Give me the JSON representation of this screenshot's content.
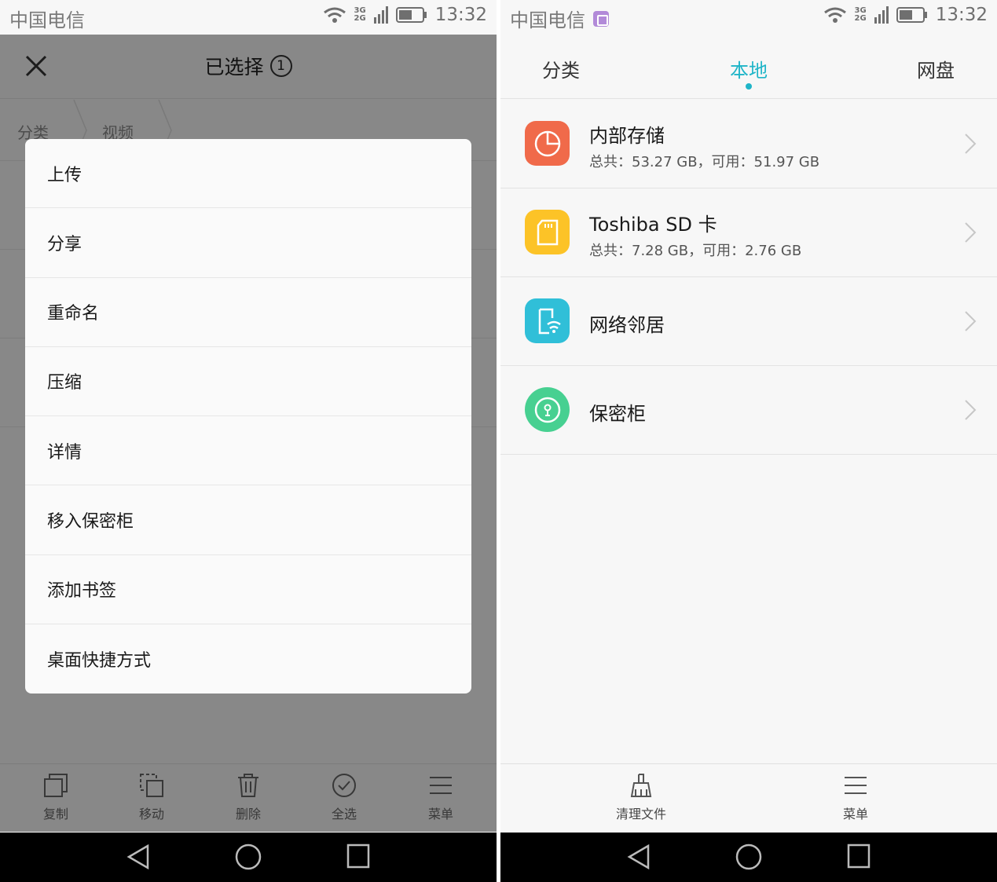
{
  "status": {
    "carrier": "中国电信",
    "network_top": "3G",
    "network_bottom": "2G",
    "time": "13:32"
  },
  "left": {
    "header_title": "已选择",
    "selected_count": "1",
    "breadcrumb": [
      "分类",
      "视频"
    ],
    "menu_items": [
      "上传",
      "分享",
      "重命名",
      "压缩",
      "详情",
      "移入保密柜",
      "添加书签",
      "桌面快捷方式"
    ],
    "toolbar": [
      "复制",
      "移动",
      "删除",
      "全选",
      "菜单"
    ]
  },
  "right": {
    "tabs": [
      "分类",
      "本地",
      "网盘"
    ],
    "active_tab": "本地",
    "storage": [
      {
        "title": "内部存储",
        "subtitle": "总共：53.27 GB，可用：51.97 GB",
        "icon": "pie-chart-icon",
        "color": "#f06a4a"
      },
      {
        "title": "Toshiba SD 卡",
        "subtitle": "总共：7.28 GB，可用：2.76 GB",
        "icon": "sd-card-icon",
        "color": "#fcc327"
      },
      {
        "title": "网络邻居",
        "subtitle": "",
        "icon": "network-device-icon",
        "color": "#30bfd8"
      },
      {
        "title": "保密柜",
        "subtitle": "",
        "icon": "safe-lock-icon",
        "color": "#47d091"
      }
    ],
    "toolbar": [
      "清理文件",
      "菜单"
    ]
  },
  "colors": {
    "accent": "#1fb5c8"
  }
}
